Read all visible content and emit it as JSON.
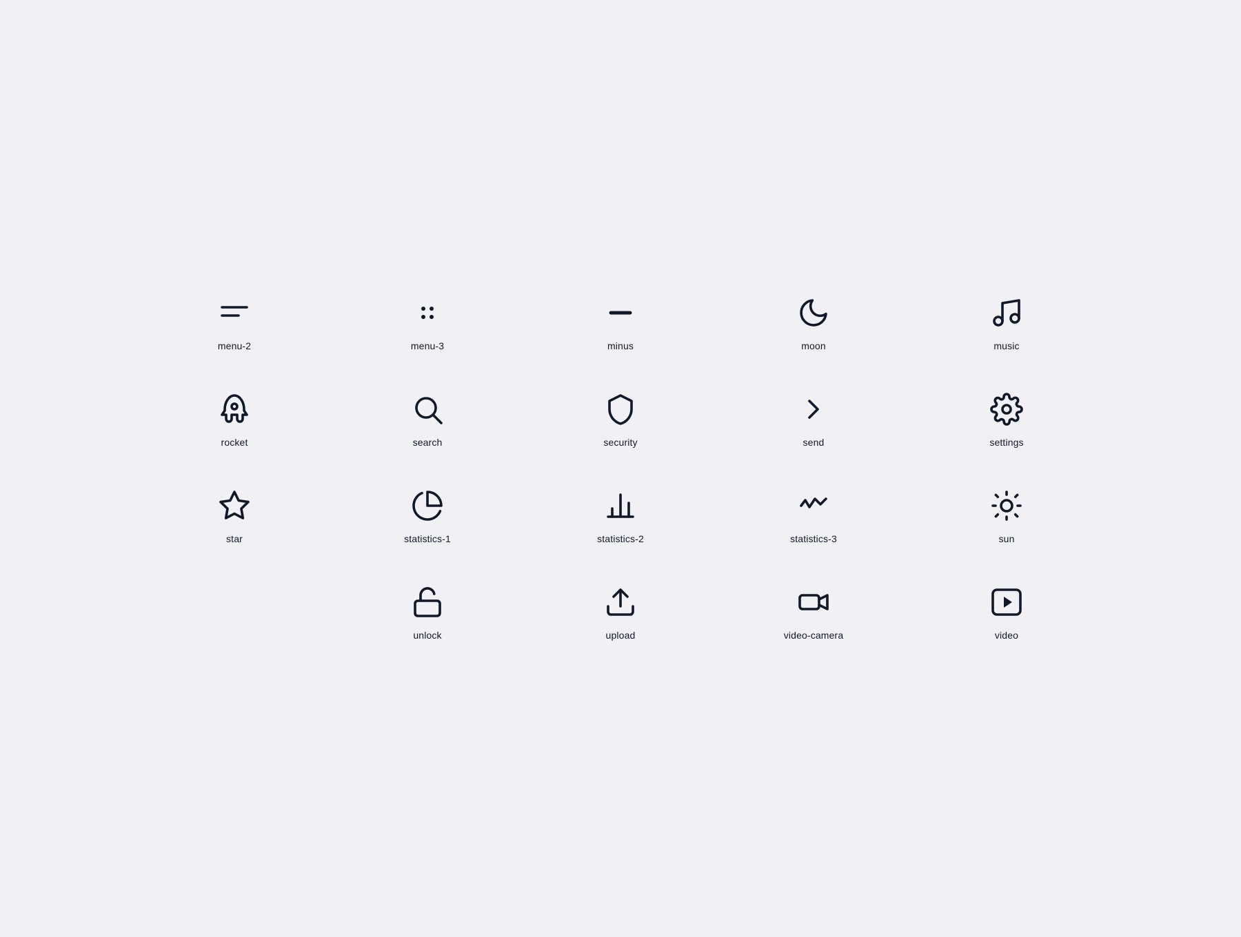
{
  "icons": [
    {
      "id": "menu-2",
      "label": "menu-2"
    },
    {
      "id": "menu-3",
      "label": "menu-3"
    },
    {
      "id": "minus",
      "label": "minus"
    },
    {
      "id": "moon",
      "label": "moon"
    },
    {
      "id": "music",
      "label": "music"
    },
    {
      "id": "rocket",
      "label": "rocket"
    },
    {
      "id": "search",
      "label": "search"
    },
    {
      "id": "security",
      "label": "security"
    },
    {
      "id": "send",
      "label": "send"
    },
    {
      "id": "settings",
      "label": "settings"
    },
    {
      "id": "star",
      "label": "star"
    },
    {
      "id": "statistics-1",
      "label": "statistics-1"
    },
    {
      "id": "statistics-2",
      "label": "statistics-2"
    },
    {
      "id": "statistics-3",
      "label": "statistics-3"
    },
    {
      "id": "sun",
      "label": "sun"
    },
    {
      "id": "empty-1",
      "label": ""
    },
    {
      "id": "unlock",
      "label": "unlock"
    },
    {
      "id": "upload",
      "label": "upload"
    },
    {
      "id": "video-camera",
      "label": "video-camera"
    },
    {
      "id": "video",
      "label": "video"
    }
  ]
}
